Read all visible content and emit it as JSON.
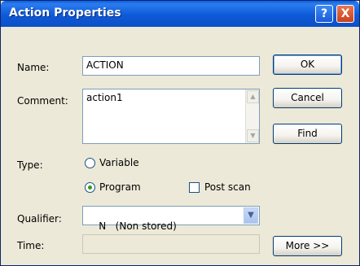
{
  "window": {
    "title": "Action Properties",
    "help_glyph": "?",
    "close_glyph": "X"
  },
  "form": {
    "name_label": "Name:",
    "name_value": "ACTION",
    "comment_label": "Comment:",
    "comment_value": "action1",
    "type_label": "Type:",
    "type_options": [
      {
        "label": "Variable",
        "selected": false
      },
      {
        "label": "Program",
        "selected": true
      }
    ],
    "post_scan_label": "Post scan",
    "post_scan_checked": false,
    "qualifier_label": "Qualifier:",
    "qualifier_value": "N   (Non stored)",
    "time_label": "Time:",
    "time_value": ""
  },
  "buttons": {
    "ok": "OK",
    "cancel": "Cancel",
    "find": "Find",
    "more": "More >>"
  },
  "icons": {
    "scroll_up": "scroll-up-arrow-icon",
    "scroll_down": "scroll-down-arrow-icon",
    "combo": "chevron-down-icon"
  }
}
